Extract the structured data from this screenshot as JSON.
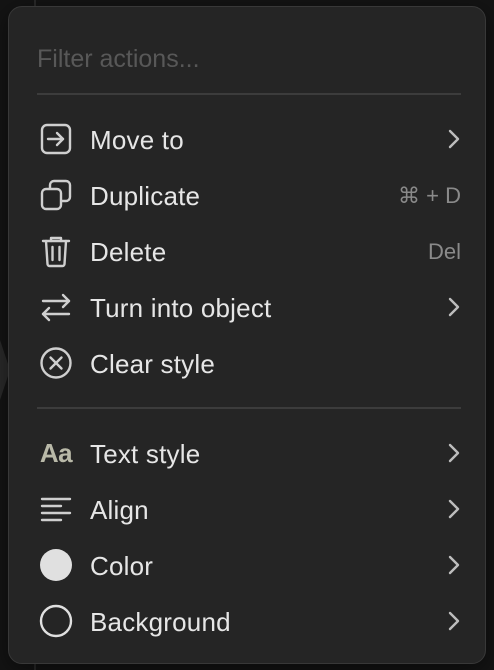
{
  "filter": {
    "placeholder": "Filter actions..."
  },
  "actions": [
    {
      "label": "Move to",
      "icon": "move-to-icon",
      "has_submenu": true
    },
    {
      "label": "Duplicate",
      "icon": "duplicate-icon",
      "shortcut": "⌘ + D"
    },
    {
      "label": "Delete",
      "icon": "trash-icon",
      "shortcut": "Del"
    },
    {
      "label": "Turn into object",
      "icon": "swap-arrows-icon",
      "has_submenu": true
    },
    {
      "label": "Clear style",
      "icon": "clear-style-icon"
    }
  ],
  "style_options": [
    {
      "label": "Text style",
      "icon": "text-style-icon",
      "icon_text": "Aa",
      "has_submenu": true
    },
    {
      "label": "Align",
      "icon": "align-left-icon",
      "has_submenu": true
    },
    {
      "label": "Color",
      "icon": "filled-circle-icon",
      "has_submenu": true
    },
    {
      "label": "Background",
      "icon": "empty-circle-icon",
      "has_submenu": true
    }
  ],
  "colors": {
    "menu_bg": "#252525",
    "text": "#e6e6e6",
    "muted": "#8a8a8a",
    "icon": "#cfcfcf",
    "color_swatch": "#e0e0e0"
  }
}
